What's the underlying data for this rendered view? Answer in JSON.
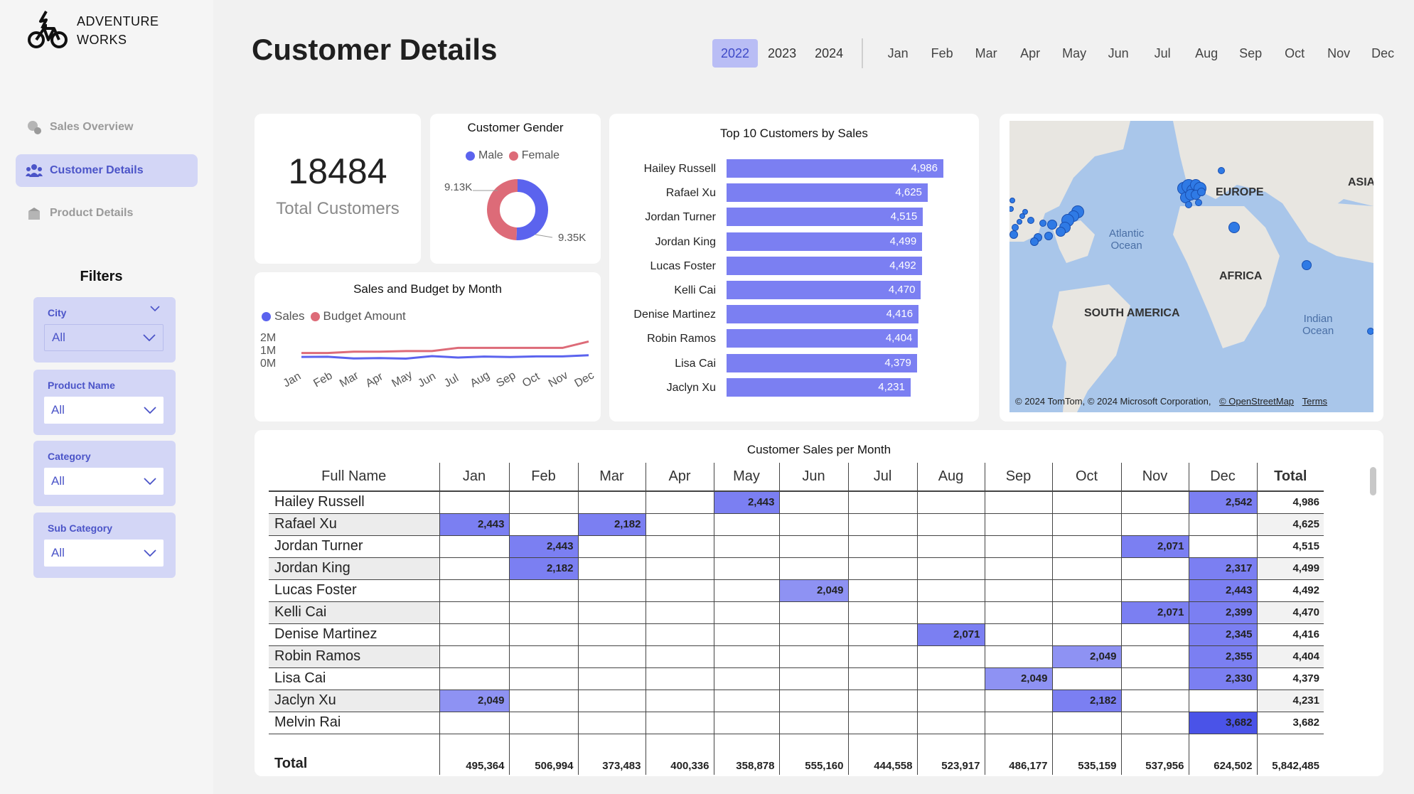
{
  "brand": {
    "line1": "ADVENTURE",
    "line2": "WORKS"
  },
  "nav": [
    {
      "label": "Sales Overview",
      "icon": "sales-icon",
      "active": false
    },
    {
      "label": "Customer Details",
      "icon": "users-icon",
      "active": true
    },
    {
      "label": "Product Details",
      "icon": "box-icon",
      "active": false
    }
  ],
  "filters": {
    "title": "Filters",
    "items": [
      {
        "label": "City",
        "value": "All"
      },
      {
        "label": "Product Name",
        "value": "All"
      },
      {
        "label": "Category",
        "value": "All"
      },
      {
        "label": "Sub Category",
        "value": "All"
      }
    ]
  },
  "page_title": "Customer Details",
  "years": [
    "2022",
    "2023",
    "2024"
  ],
  "selected_year": "2022",
  "months": [
    "Jan",
    "Feb",
    "Mar",
    "Apr",
    "May",
    "Jun",
    "Jul",
    "Aug",
    "Sep",
    "Oct",
    "Nov",
    "Dec"
  ],
  "kpi": {
    "value": "18484",
    "label": "Total Customers"
  },
  "colors": {
    "accent": "#7b7ff2",
    "male": "#5b63ee",
    "female": "#dd6b78",
    "dark_accent": "#4b54c8"
  },
  "gender_chart": {
    "title": "Customer Gender",
    "legend": [
      "Male",
      "Female"
    ],
    "labels": [
      "9.13K",
      "9.35K"
    ]
  },
  "sales_budget": {
    "title": "Sales and Budget by Month",
    "legend": [
      "Sales",
      "Budget Amount"
    ],
    "yticks": [
      "2M",
      "1M",
      "0M"
    ]
  },
  "top_customers": {
    "title": "Top 10 Customers by Sales"
  },
  "map": {
    "labels": {
      "europe": "EUROPE",
      "asia": "ASIA",
      "africa": "AFRICA",
      "south_america": "SOUTH AMERICA",
      "atlantic": "Atlantic\nOcean",
      "indian": "Indian\nOcean"
    },
    "attribution": "© 2024 TomTom, © 2024 Microsoft Corporation,",
    "osm_link": "© OpenStreetMap",
    "terms_link": "Terms"
  },
  "matrix": {
    "title": "Customer Sales per Month",
    "name_header": "Full Name",
    "total_header": "Total",
    "rows": [
      {
        "name": "Hailey Russell",
        "cells": [
          "",
          "",
          "",
          "",
          "2,443",
          "",
          "",
          "",
          "",
          "",
          "",
          "2,542"
        ],
        "total": "4,986"
      },
      {
        "name": "Rafael Xu",
        "cells": [
          "2,443",
          "",
          "2,182",
          "",
          "",
          "",
          "",
          "",
          "",
          "",
          "",
          ""
        ],
        "total": "4,625"
      },
      {
        "name": "Jordan Turner",
        "cells": [
          "",
          "2,443",
          "",
          "",
          "",
          "",
          "",
          "",
          "",
          "",
          "2,071",
          ""
        ],
        "total": "4,515"
      },
      {
        "name": "Jordan King",
        "cells": [
          "",
          "2,182",
          "",
          "",
          "",
          "",
          "",
          "",
          "",
          "",
          "",
          "2,317"
        ],
        "total": "4,499"
      },
      {
        "name": "Lucas Foster",
        "cells": [
          "",
          "",
          "",
          "",
          "",
          "2,049",
          "",
          "",
          "",
          "",
          "",
          "2,443"
        ],
        "total": "4,492"
      },
      {
        "name": "Kelli Cai",
        "cells": [
          "",
          "",
          "",
          "",
          "",
          "",
          "",
          "",
          "",
          "",
          "2,071",
          "2,399"
        ],
        "total": "4,470"
      },
      {
        "name": "Denise Martinez",
        "cells": [
          "",
          "",
          "",
          "",
          "",
          "",
          "",
          "2,071",
          "",
          "",
          "",
          "2,345"
        ],
        "total": "4,416"
      },
      {
        "name": "Robin Ramos",
        "cells": [
          "",
          "",
          "",
          "",
          "",
          "",
          "",
          "",
          "",
          "2,049",
          "",
          "2,355"
        ],
        "total": "4,404"
      },
      {
        "name": "Lisa Cai",
        "cells": [
          "",
          "",
          "",
          "",
          "",
          "",
          "",
          "",
          "2,049",
          "",
          "",
          "2,330"
        ],
        "total": "4,379"
      },
      {
        "name": "Jaclyn Xu",
        "cells": [
          "2,049",
          "",
          "",
          "",
          "",
          "",
          "",
          "",
          "",
          "2,182",
          "",
          ""
        ],
        "total": "4,231"
      },
      {
        "name": "Melvin Rai",
        "cells": [
          "",
          "",
          "",
          "",
          "",
          "",
          "",
          "",
          "",
          "",
          "",
          "3,682"
        ],
        "total": "3,682"
      }
    ],
    "totals_label": "Total",
    "totals": [
      "495,364",
      "506,994",
      "373,483",
      "400,336",
      "358,878",
      "555,160",
      "444,558",
      "523,917",
      "486,177",
      "535,159",
      "537,956",
      "624,502"
    ],
    "grand_total": "5,842,485"
  },
  "chart_data": [
    {
      "type": "pie",
      "title": "Customer Gender",
      "categories": [
        "Male",
        "Female"
      ],
      "values": [
        9350,
        9130
      ],
      "value_labels": [
        "9.35K",
        "9.13K"
      ]
    },
    {
      "type": "line",
      "title": "Sales and Budget by Month",
      "categories": [
        "Jan",
        "Feb",
        "Mar",
        "Apr",
        "May",
        "Jun",
        "Jul",
        "Aug",
        "Sep",
        "Oct",
        "Nov",
        "Dec"
      ],
      "series": [
        {
          "name": "Sales",
          "values": [
            495364,
            506994,
            373483,
            400336,
            358878,
            555160,
            444558,
            523917,
            486177,
            535159,
            537956,
            624502
          ]
        },
        {
          "name": "Budget Amount",
          "values": [
            800000,
            800000,
            900000,
            900000,
            950000,
            950000,
            1200000,
            1200000,
            1200000,
            1200000,
            1200000,
            1700000
          ]
        }
      ],
      "ylim": [
        0,
        2000000
      ],
      "yticks": [
        "0M",
        "1M",
        "2M"
      ]
    },
    {
      "type": "bar",
      "title": "Top 10 Customers by Sales",
      "categories": [
        "Hailey Russell",
        "Rafael Xu",
        "Jordan Turner",
        "Jordan King",
        "Lucas Foster",
        "Kelli Cai",
        "Denise Martinez",
        "Robin Ramos",
        "Lisa Cai",
        "Jaclyn Xu"
      ],
      "values": [
        4986,
        4625,
        4515,
        4499,
        4492,
        4470,
        4416,
        4404,
        4379,
        4231
      ],
      "value_labels": [
        "4,986",
        "4,625",
        "4,515",
        "4,499",
        "4,492",
        "4,470",
        "4,416",
        "4,404",
        "4,379",
        "4,231"
      ],
      "orientation": "horizontal"
    }
  ]
}
